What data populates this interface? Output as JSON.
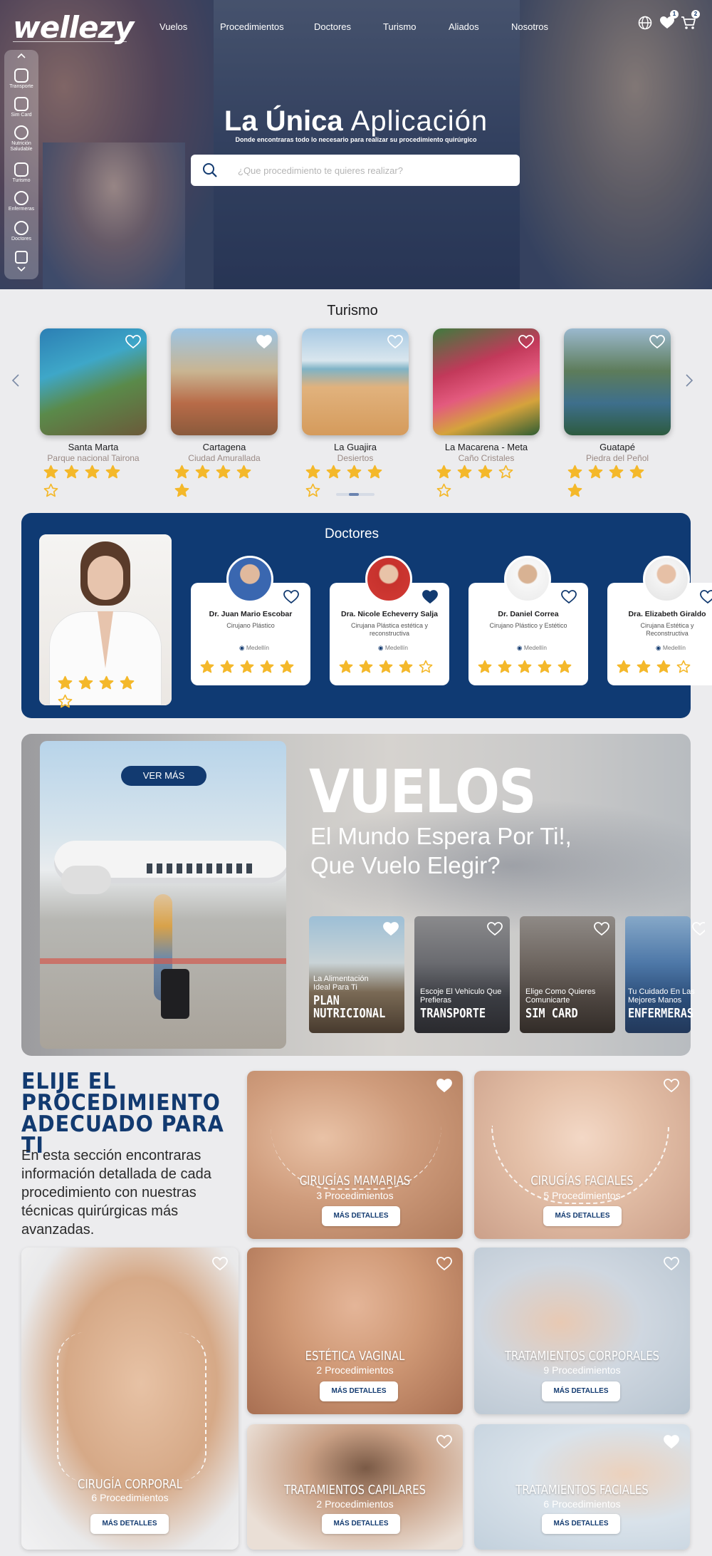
{
  "brand": {
    "logo": "wellezy"
  },
  "nav": [
    "Vuelos",
    "Procedimientos",
    "Doctores",
    "Turismo",
    "Aliados",
    "Nosotros"
  ],
  "header_icons": {
    "favorites_badge": "1",
    "cart_badge": "2"
  },
  "sidebar": [
    {
      "label": "Transporte",
      "icon": "car-icon"
    },
    {
      "label": "Sim Card",
      "icon": "sim-card-icon"
    },
    {
      "label": "Nutrición Saludable",
      "icon": "nutrition-icon"
    },
    {
      "label": "Turismo",
      "icon": "tourism-icon"
    },
    {
      "label": "Enfermeras",
      "icon": "nurse-icon"
    },
    {
      "label": "Doctores",
      "icon": "doctors-icon"
    }
  ],
  "hero": {
    "title_bold": "La Única",
    "title_light": "Aplicación",
    "subtitle": "Donde encontraras todo lo necesario para realizar su procedimiento quirúrgico",
    "search_placeholder": "¿Que procedimiento te quieres realizar?"
  },
  "turismo": {
    "title": "Turismo",
    "items": [
      {
        "name": "Santa Marta",
        "sub": "Parque nacional Tairona",
        "rating": 4
      },
      {
        "name": "Cartagena",
        "sub": "Ciudad Amurallada",
        "rating": 5
      },
      {
        "name": "La Guajira",
        "sub": "Desiertos",
        "rating": 4
      },
      {
        "name": "La Macarena - Meta",
        "sub": "Caño Cristales",
        "rating": 3
      },
      {
        "name": "Guatapé",
        "sub": "Piedra del Peñol",
        "rating": 5
      }
    ]
  },
  "doctores": {
    "title": "Doctores",
    "featured_rating": 4,
    "items": [
      {
        "name": "Dr. Juan Mario Escobar",
        "spec": "Cirujano Plástico",
        "city": "Medellín",
        "rating": 5,
        "favorite": false
      },
      {
        "name": "Dra. Nicole Echeverry Salja",
        "spec": "Cirujana Plástica estética y reconstructiva",
        "city": "Medellín",
        "rating": 4,
        "favorite": true
      },
      {
        "name": "Dr. Daniel Correa",
        "spec": "Cirujano Plástico y Estético",
        "city": "Medellín",
        "rating": 5,
        "favorite": false
      },
      {
        "name": "Dra. Elizabeth Giraldo",
        "spec": "Cirujana Estética y Reconstructiva",
        "city": "Medellín",
        "rating": 3,
        "favorite": false
      }
    ]
  },
  "vuelos": {
    "button": "VER MÁS",
    "title": "VUELOS",
    "line1": "El Mundo Espera Por Ti!,",
    "line2": "Que Vuelo Elegir?",
    "cards": [
      {
        "small": "La Alimentación Ideal Para Ti",
        "big": "PLAN NUTRICIONAL",
        "favorite": true
      },
      {
        "small": "Escoje El Vehiculo Que Prefieras",
        "big": "TRANSPORTE",
        "favorite": false
      },
      {
        "small": "Elige Como Quieres Comunicarte",
        "big": "SIM CARD",
        "favorite": false
      },
      {
        "small": "Tu Cuidado En Las Mejores Manos",
        "big": "ENFERMERAS",
        "favorite": false
      }
    ]
  },
  "procedimientos": {
    "heading": "ELIJE EL PROCEDIMIENTO ADECUADO PARA TI",
    "text": "En esta sección encontraras información detallada de cada procedimiento con nuestras técnicas quirúrgicas más avanzadas.",
    "button": "MÁS DETALLES",
    "items": [
      {
        "name": "CIRUGÍAS MAMARIAS",
        "count": "3 Procedimientos",
        "favorite": true
      },
      {
        "name": "CIRUGÍAS FACIALES",
        "count": "5 Procedimientos",
        "favorite": false
      },
      {
        "name": "CIRUGÍA CORPORAL",
        "count": "6 Procedimientos",
        "favorite": false
      },
      {
        "name": "ESTÉTICA VAGINAL",
        "count": "2 Procedimientos",
        "favorite": false
      },
      {
        "name": "TRATAMIENTOS CORPORALES",
        "count": "9 Procedimientos",
        "favorite": false
      },
      {
        "name": "TRATAMIENTOS CAPILARES",
        "count": "2 Procedimientos",
        "favorite": false
      },
      {
        "name": "TRATAMIENTOS FACIALES",
        "count": "6 Procedimientos",
        "favorite": true
      }
    ]
  },
  "colors": {
    "primary": "#123a70",
    "star": "#f4b82a",
    "panel": "#0f3a73"
  }
}
